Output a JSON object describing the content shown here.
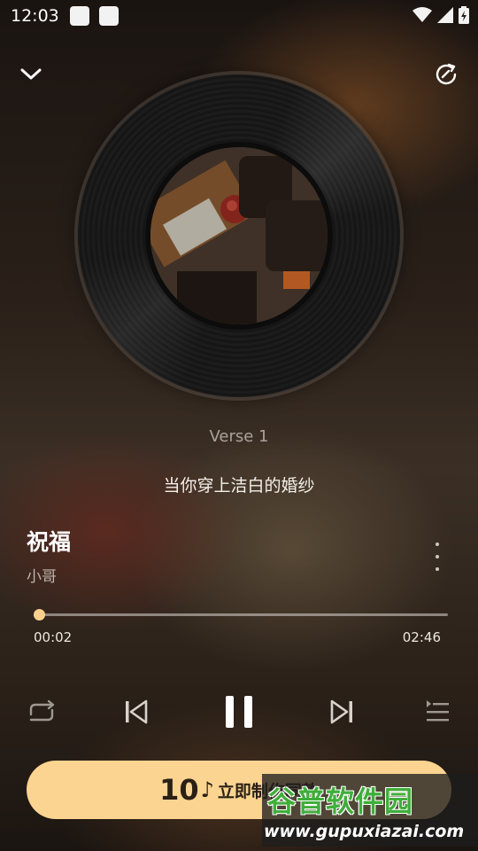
{
  "status_bar": {
    "time": "12:03"
  },
  "header": {
    "collapse_icon": "chevron-down-icon",
    "share_icon": "share-refresh-icon"
  },
  "player": {
    "section": "Verse 1",
    "lyric": "当你穿上洁白的婚纱",
    "song_title": "祝福",
    "artist": "小哥",
    "current_time": "00:02",
    "total_time": "02:46",
    "progress": 0.012
  },
  "controls": {
    "repeat_icon": "repeat-icon",
    "prev_icon": "skip-previous-icon",
    "pause_icon": "pause-icon",
    "next_icon": "skip-next-icon",
    "playlist_icon": "playlist-icon"
  },
  "cta": {
    "number": "10",
    "label": "立即制作同款"
  },
  "watermark": {
    "title": "谷普软件园",
    "url": "www.gupuxiazai.com"
  },
  "colors": {
    "accent": "#fcd491",
    "background": "#2a2019"
  }
}
